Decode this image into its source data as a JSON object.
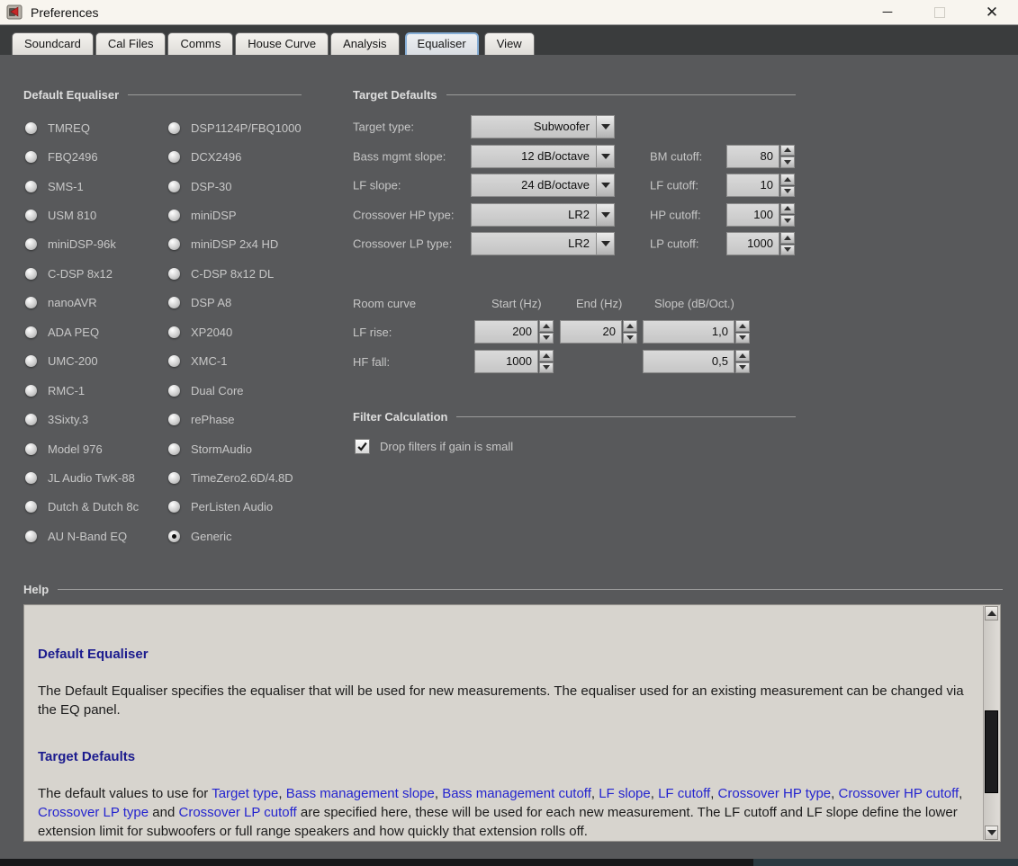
{
  "window": {
    "title": "Preferences",
    "controls": {
      "minimize": "─",
      "close": "✕"
    }
  },
  "tabs": {
    "active": "Equaliser",
    "items": [
      {
        "label": "Soundcard"
      },
      {
        "label": "Cal Files"
      },
      {
        "label": "Comms"
      },
      {
        "label": "House Curve"
      },
      {
        "label": "Analysis"
      },
      {
        "label": "Equaliser"
      },
      {
        "label": "View"
      }
    ]
  },
  "default_equaliser": {
    "title": "Default Equaliser",
    "selected": "Generic",
    "columns": [
      [
        "TMREQ",
        "FBQ2496",
        "SMS-1",
        "USM 810",
        "miniDSP-96k",
        "C-DSP 8x12",
        "nanoAVR",
        "ADA PEQ",
        "UMC-200",
        "RMC-1",
        "3Sixty.3",
        "Model 976",
        "JL Audio TwK-88",
        "Dutch & Dutch 8c",
        "AU N-Band EQ"
      ],
      [
        "DSP1124P/FBQ1000",
        "DCX2496",
        "DSP-30",
        "miniDSP",
        "miniDSP 2x4 HD",
        "C-DSP 8x12 DL",
        "DSP A8",
        "XP2040",
        "XMC-1",
        "Dual Core",
        "rePhase",
        "StormAudio",
        "TimeZero2.6D/4.8D",
        "PerListen Audio",
        "Generic"
      ]
    ]
  },
  "target_defaults": {
    "title": "Target Defaults",
    "rows": [
      {
        "label": "Target type:",
        "value": "Subwoofer"
      },
      {
        "label": "Bass mgmt slope:",
        "value": "12 dB/octave",
        "cutoff_label": "BM cutoff:",
        "cutoff_value": "80"
      },
      {
        "label": "LF slope:",
        "value": "24 dB/octave",
        "cutoff_label": "LF cutoff:",
        "cutoff_value": "10"
      },
      {
        "label": "Crossover HP type:",
        "value": "LR2",
        "cutoff_label": "HP cutoff:",
        "cutoff_value": "100"
      },
      {
        "label": "Crossover LP type:",
        "value": "LR2",
        "cutoff_label": "LP cutoff:",
        "cutoff_value": "1000"
      }
    ],
    "room_curve": {
      "label": "Room curve",
      "headers": [
        "Start (Hz)",
        "End (Hz)",
        "Slope (dB/Oct.)"
      ],
      "rows": [
        {
          "label": "LF rise:",
          "start": "200",
          "end": "20",
          "slope": "1,0"
        },
        {
          "label": "HF fall:",
          "start": "1000",
          "end": null,
          "slope": "0,5"
        }
      ]
    }
  },
  "filter_calculation": {
    "title": "Filter Calculation",
    "checkbox": {
      "label": "Drop filters if gain is small",
      "checked": true
    }
  },
  "help": {
    "title": "Help",
    "sections": [
      {
        "heading": "Default Equaliser",
        "segments": [
          {
            "text": "The Default Equaliser specifies the equaliser that will be used for new measurements. The equaliser used for an existing measurement can be changed via the EQ panel.",
            "link": false
          }
        ]
      },
      {
        "heading": "Target Defaults",
        "segments": [
          {
            "text": "The default values to use for ",
            "link": false
          },
          {
            "text": "Target type",
            "link": true
          },
          {
            "text": ", ",
            "link": false
          },
          {
            "text": "Bass management slope",
            "link": true
          },
          {
            "text": ", ",
            "link": false
          },
          {
            "text": "Bass management cutoff",
            "link": true
          },
          {
            "text": ", ",
            "link": false
          },
          {
            "text": "LF slope",
            "link": true
          },
          {
            "text": ", ",
            "link": false
          },
          {
            "text": "LF cutoff",
            "link": true
          },
          {
            "text": ", ",
            "link": false
          },
          {
            "text": "Crossover HP type",
            "link": true
          },
          {
            "text": ", ",
            "link": false
          },
          {
            "text": "Crossover HP cutoff",
            "link": true
          },
          {
            "text": ", ",
            "link": false
          },
          {
            "text": "Crossover LP type",
            "link": true
          },
          {
            "text": " and ",
            "link": false
          },
          {
            "text": "Crossover LP cutoff",
            "link": true
          },
          {
            "text": " are specified here, these will be used for each new measurement. The LF cutoff and LF slope define the lower extension limit for subwoofers or full range speakers and how quickly that extension rolls off.",
            "link": false
          }
        ]
      }
    ]
  },
  "colors": {
    "panel_bg": "#58595b",
    "titlebar_bg": "#f8f5ef",
    "tab_active_outline": "#86aed6",
    "help_bg": "#d7d4ce",
    "help_heading": "#1b1b8e",
    "help_link": "#2424cf",
    "label_text": "#c8c8c8"
  }
}
